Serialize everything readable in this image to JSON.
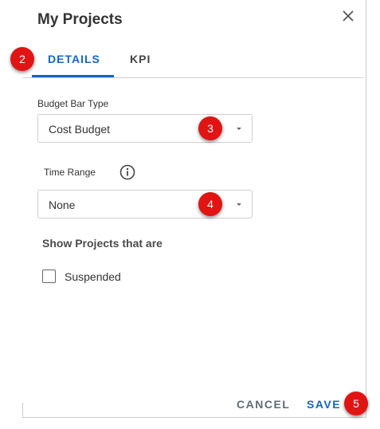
{
  "dialog": {
    "title": "My Projects",
    "close_icon": "close-icon"
  },
  "tabs": [
    {
      "label": "DETAILS",
      "active": true
    },
    {
      "label": "KPI",
      "active": false
    }
  ],
  "budget_bar": {
    "label": "Budget Bar Type",
    "value": "Cost Budget"
  },
  "time_range": {
    "label": "Time Range",
    "info_icon": "info-icon",
    "value": "None"
  },
  "show_projects": {
    "title": "Show Projects that are",
    "options": [
      {
        "label": "Suspended",
        "checked": false
      }
    ]
  },
  "actions": {
    "cancel_label": "CANCEL",
    "save_label": "SAVE"
  },
  "markers": {
    "tabs": "2",
    "budget": "3",
    "time_range": "4",
    "save": "5"
  },
  "colors": {
    "accent": "#1565c0",
    "marker": "#e11414"
  }
}
